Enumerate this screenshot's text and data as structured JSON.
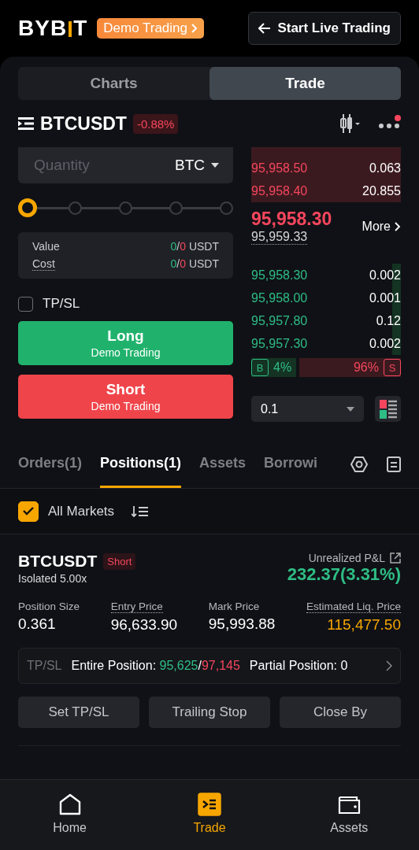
{
  "header": {
    "logo_left": "BYB",
    "logo_right": "T",
    "demo_badge": "Demo Trading",
    "live_button": "Start Live Trading"
  },
  "view_tabs": [
    {
      "label": "Charts",
      "selected": false
    },
    {
      "label": "Trade",
      "selected": true
    }
  ],
  "symbol": {
    "name": "BTCUSDT",
    "change": "-0.88%",
    "notification": true
  },
  "order_form": {
    "quantity": {
      "placeholder": "Quantity",
      "unit": "BTC"
    },
    "slider": {
      "level": 0
    },
    "summary": [
      {
        "label": "Value",
        "long": "0",
        "separator": "/",
        "short": "0",
        "unit": "USDT",
        "dotted": false
      },
      {
        "label": "Cost",
        "long": "0",
        "separator": "/",
        "short": "0",
        "unit": "USDT",
        "dotted": true
      }
    ],
    "tpsl": {
      "label": "TP/SL",
      "checked": false
    },
    "buttons": [
      {
        "kind": "long",
        "label": "Long",
        "sublabel": "Demo Trading"
      },
      {
        "kind": "short",
        "label": "Short",
        "sublabel": "Demo Trading"
      }
    ]
  },
  "order_book": {
    "asks": [
      {
        "price": "95,958.50",
        "size": "0.063"
      },
      {
        "price": "95,958.40",
        "size": "20.855"
      }
    ],
    "last_price": "95,958.30",
    "mark_price": "95,959.33",
    "more": "More",
    "bids": [
      {
        "price": "95,958.30",
        "size": "0.002"
      },
      {
        "price": "95,958.00",
        "size": "0.001"
      },
      {
        "price": "95,957.80",
        "size": "0.12"
      },
      {
        "price": "95,957.30",
        "size": "0.002"
      }
    ],
    "ratio": {
      "buy_label": "B",
      "buy": "4%",
      "sell": "96%",
      "sell_label": "S"
    },
    "precision": "0.1"
  },
  "position_tabs": [
    {
      "label": "Orders(1)",
      "selected": false
    },
    {
      "label": "Positions(1)",
      "selected": true
    },
    {
      "label": "Assets",
      "selected": false
    },
    {
      "label": "Borrowi",
      "selected": false
    }
  ],
  "filter": {
    "label": "All Markets",
    "checked": true
  },
  "position": {
    "symbol": "BTCUSDT",
    "side": "Short",
    "margin": "Isolated 5.00x",
    "pnl_label": "Unrealized P&L",
    "pnl": "232.37(3.31%)",
    "fields": [
      {
        "label": "Position Size",
        "value": "0.361",
        "kind": "plain"
      },
      {
        "label": "Entry Price",
        "value": "96,633.90",
        "kind": "dotted"
      },
      {
        "label": "Mark Price",
        "value": "95,993.88",
        "kind": "plain"
      },
      {
        "label": "Estimated Liq. Price",
        "value": "115,477.50",
        "kind": "liquidation"
      }
    ],
    "tpsl": {
      "label": "TP/SL",
      "entire_label": "Entire Position:",
      "tp": "95,625",
      "separator": "/",
      "sl": "97,145",
      "partial": "Partial Position: 0"
    },
    "actions": [
      "Set TP/SL",
      "Trailing Stop",
      "Close By"
    ]
  },
  "nav": [
    {
      "label": "Home",
      "selected": false
    },
    {
      "label": "Trade",
      "selected": true
    },
    {
      "label": "Assets",
      "selected": false
    }
  ]
}
